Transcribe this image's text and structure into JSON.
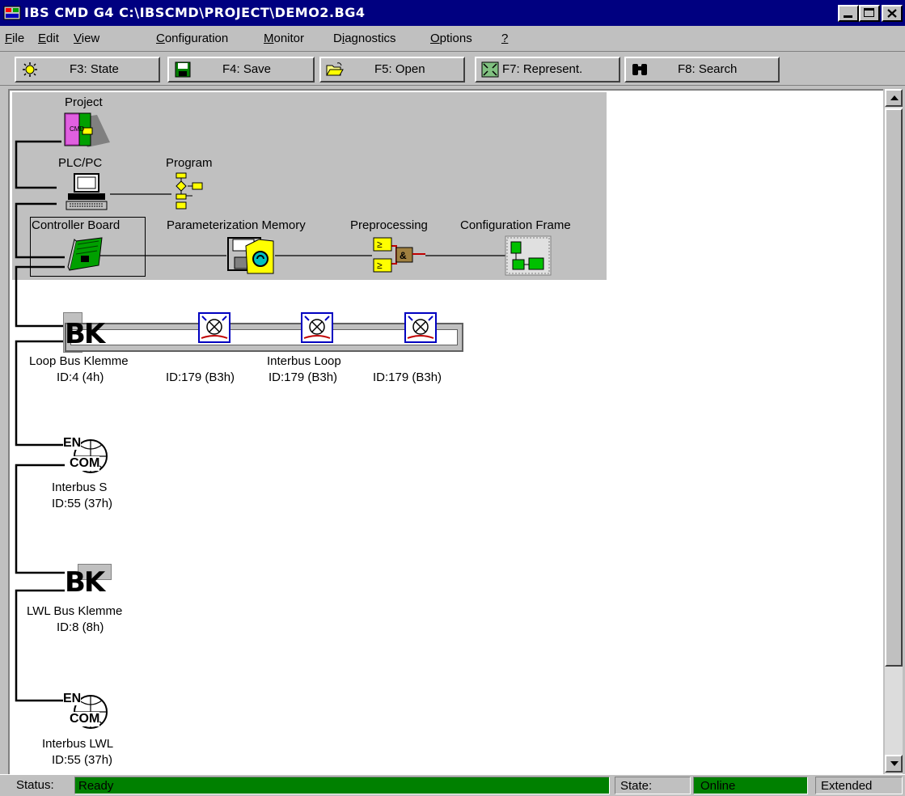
{
  "window": {
    "title": "IBS CMD G4 C:\\IBSCMD\\PROJECT\\DEMO2.BG4",
    "buttons": [
      "minimize",
      "maximize",
      "close"
    ]
  },
  "menu": {
    "file": "File",
    "edit": "Edit",
    "view": "View",
    "configuration": "Configuration",
    "monitor": "Monitor",
    "diagnostics": "Diagnostics",
    "options": "Options",
    "help": "?"
  },
  "toolbar": {
    "state": "F3: State",
    "save": "F4: Save",
    "open": "F5: Open",
    "represent": "F7: Represent.",
    "search": "F8: Search"
  },
  "tree": {
    "project": "Project",
    "plc": "PLC/PC",
    "program": "Program",
    "controller_board": "Controller Board",
    "param_memory": "Parameterization Memory",
    "preprocessing": "Preprocessing",
    "config_frame": "Configuration Frame",
    "loop_bk_label": "Loop Bus Klemme",
    "loop_bk_id": "ID:4 (4h)",
    "loop_title": "Interbus Loop",
    "loop_dev1_id": "ID:179 (B3h)",
    "loop_dev2_id": "ID:179 (B3h)",
    "loop_dev3_id": "ID:179 (B3h)",
    "encom1_label": "Interbus S",
    "encom1_id": "ID:55 (37h)",
    "lwl_bk_label": "LWL Bus Klemme",
    "lwl_bk_id": "ID:8 (8h)",
    "encom2_label": "Interbus LWL",
    "encom2_id": "ID:55 (37h)",
    "bk_text": "BK",
    "encom_text_top": "EN",
    "encom_text_bottom": "COM"
  },
  "status": {
    "status_label": "Status:",
    "status_value": "Ready",
    "state_label": "State:",
    "state_value": "Online",
    "mode": "Extended"
  },
  "colors": {
    "titlebar": "#000080",
    "status_green": "#008000",
    "client_bg": "#ffffff",
    "panel_gray": "#c0c0c0"
  }
}
